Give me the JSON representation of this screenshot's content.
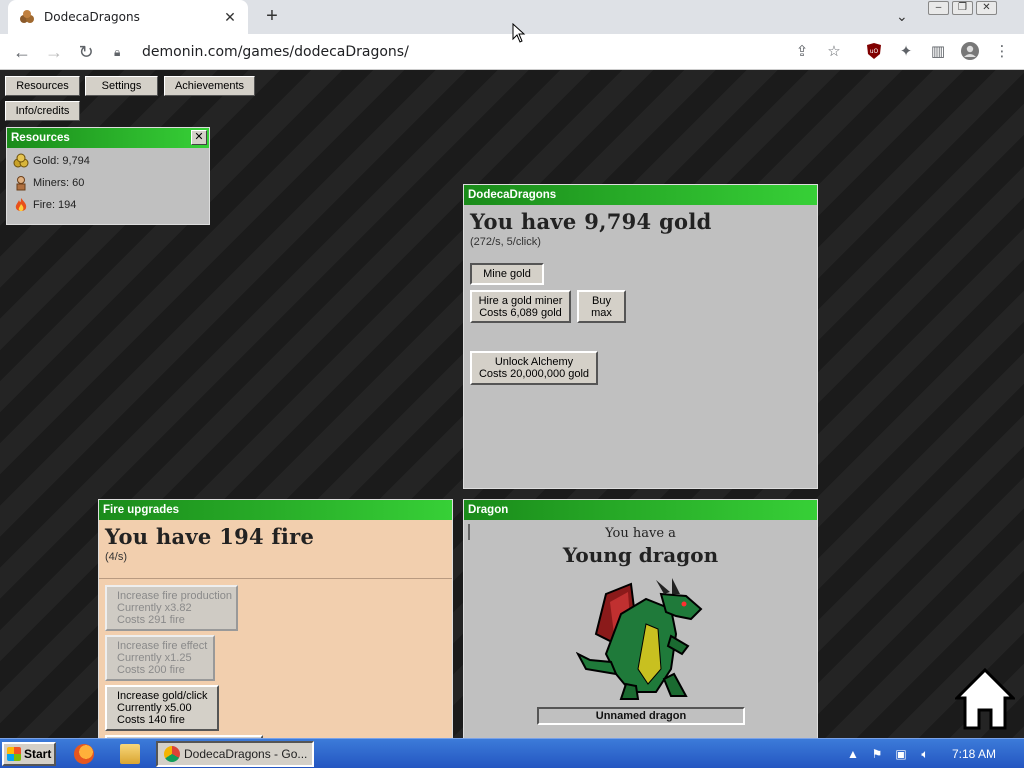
{
  "browser": {
    "tab_title": "DodecaDragons",
    "url": "demonin.com/games/dodecaDragons/"
  },
  "menu": {
    "resources": "Resources",
    "settings": "Settings",
    "achievements": "Achievements",
    "info": "Info/credits"
  },
  "resources_panel": {
    "title": "Resources",
    "close": "✕",
    "gold": "Gold: 9,794",
    "miners": "Miners: 60",
    "fire": "Fire: 194"
  },
  "main_panel": {
    "title": "DodecaDragons",
    "gold_heading": "You have 9,794 gold",
    "gold_rate": "(272/s, 5/click)",
    "mine_gold": "Mine gold",
    "hire_miner_line1": "Hire a gold miner",
    "hire_miner_line2": "Costs 6,089 gold",
    "buy_max_line1": "Buy",
    "buy_max_line2": "max",
    "alchemy_line1": "Unlock Alchemy",
    "alchemy_line2": "Costs 20,000,000 gold"
  },
  "fire_panel": {
    "title": "Fire upgrades",
    "fire_heading": "You have 194 fire",
    "fire_rate": "(4/s)",
    "upgrades": [
      {
        "l1": "Increase fire production",
        "l2": "Currently x3.82",
        "l3": "Costs 291 fire"
      },
      {
        "l1": "Increase fire effect",
        "l2": "Currently x1.25",
        "l3": "Costs 200 fire"
      },
      {
        "l1": "Increase gold/click",
        "l2": "Currently x5.00",
        "l3": "Costs 140 fire"
      }
    ]
  },
  "dragon_panel": {
    "title": "Dragon",
    "you_have": "You have a",
    "dragon_type": "Young dragon",
    "dragon_name": "Unnamed dragon"
  },
  "taskbar": {
    "start": "Start",
    "task": "DodecaDragons - Go...",
    "clock": "7:18 AM"
  },
  "colors": {
    "panel_header_dark": "#1a8b1a",
    "panel_header_light": "#37d037",
    "fire_panel_bg": "#f2cfae",
    "panel_bg": "#c0c0c0"
  }
}
